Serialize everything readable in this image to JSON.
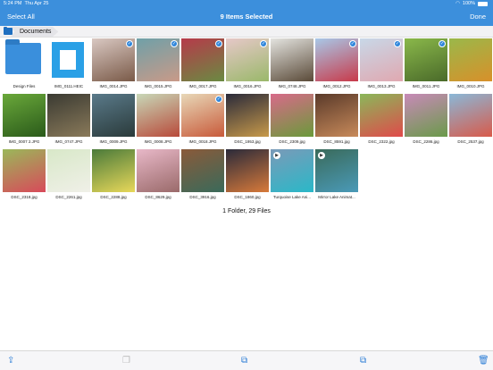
{
  "status_bar": {
    "time": "5:24 PM",
    "date": "Thu Apr 25",
    "battery": "100%"
  },
  "navbar": {
    "left": "Select All",
    "title": "9 Items Selected",
    "right": "Done"
  },
  "breadcrumb": {
    "label": "Documents"
  },
  "files": [
    {
      "name": "Design Files",
      "kind": "folder",
      "selected": false,
      "colors": [
        "#3a8fdc",
        "#3a8fdc"
      ]
    },
    {
      "name": "IMG_0111.HEIC",
      "kind": "doc",
      "selected": false,
      "colors": [
        "#2aa0e6",
        "#2aa0e6"
      ]
    },
    {
      "name": "IMG_0014.JPG",
      "kind": "photo",
      "selected": true,
      "colors": [
        "#d9c8c2",
        "#7a5a48"
      ]
    },
    {
      "name": "IMG_0015.JPG",
      "kind": "photo",
      "selected": true,
      "colors": [
        "#6fa0a8",
        "#c99a88"
      ]
    },
    {
      "name": "IMG_0017.JPG",
      "kind": "photo",
      "selected": true,
      "colors": [
        "#b63a4a",
        "#6a8a42"
      ]
    },
    {
      "name": "IMG_0016.JPG",
      "kind": "photo",
      "selected": true,
      "colors": [
        "#e6c8c8",
        "#9ab86a"
      ]
    },
    {
      "name": "IMG_0748.JPG",
      "kind": "photo",
      "selected": false,
      "colors": [
        "#e4e4e0",
        "#5a4a38"
      ]
    },
    {
      "name": "IMG_0012.JPG",
      "kind": "photo",
      "selected": true,
      "colors": [
        "#a8c8e8",
        "#c83a4a"
      ]
    },
    {
      "name": "IMG_0013.JPG",
      "kind": "photo",
      "selected": true,
      "colors": [
        "#c8d8e8",
        "#e0a8b0"
      ]
    },
    {
      "name": "IMG_0011.JPG",
      "kind": "photo",
      "selected": true,
      "colors": [
        "#8ab84a",
        "#4a6a2a"
      ]
    },
    {
      "name": "IMG_0010.JPG",
      "kind": "photo",
      "selected": false,
      "colors": [
        "#9ab84a",
        "#d8902a"
      ]
    },
    {
      "name": "IMG_0007 2.JPG",
      "kind": "photo",
      "selected": false,
      "colors": [
        "#6aa83a",
        "#2a5a1a"
      ]
    },
    {
      "name": "IMG_0747.JPG",
      "kind": "photo",
      "selected": false,
      "colors": [
        "#3a3a32",
        "#8a7a5a"
      ]
    },
    {
      "name": "IMG_0009.JPG",
      "kind": "photo",
      "selected": false,
      "colors": [
        "#5a7a8a",
        "#2a3a3a"
      ]
    },
    {
      "name": "IMG_0008.JPG",
      "kind": "photo",
      "selected": false,
      "colors": [
        "#c8d8b8",
        "#b84a3a"
      ]
    },
    {
      "name": "IMG_0018.JPG",
      "kind": "photo",
      "selected": true,
      "colors": [
        "#e8d8b8",
        "#c85a3a"
      ]
    },
    {
      "name": "DSC_1953.jpg",
      "kind": "photo",
      "selected": false,
      "colors": [
        "#2a2a3a",
        "#c89a4a"
      ]
    },
    {
      "name": "DSC_2309.jpg",
      "kind": "photo",
      "selected": false,
      "colors": [
        "#d86a8a",
        "#6a9a3a"
      ]
    },
    {
      "name": "DSC_8591.jpg",
      "kind": "photo",
      "selected": false,
      "colors": [
        "#5a3a2a",
        "#c88a5a"
      ]
    },
    {
      "name": "DSC_2322.jpg",
      "kind": "photo",
      "selected": false,
      "colors": [
        "#8ab85a",
        "#e04a4a"
      ]
    },
    {
      "name": "DSC_2286.jpg",
      "kind": "photo",
      "selected": false,
      "colors": [
        "#c88ab8",
        "#6a9a4a"
      ]
    },
    {
      "name": "DSC_2537.jpg",
      "kind": "photo",
      "selected": false,
      "colors": [
        "#8ab8d8",
        "#d85a4a"
      ]
    },
    {
      "name": "DSC_2318.jpg",
      "kind": "photo",
      "selected": false,
      "colors": [
        "#9ab85a",
        "#d84a5a"
      ]
    },
    {
      "name": "DSC_2261.jpg",
      "kind": "photo",
      "selected": false,
      "colors": [
        "#d8e8c8",
        "#f0f0e8"
      ]
    },
    {
      "name": "DSC_2288.jpg",
      "kind": "photo",
      "selected": false,
      "colors": [
        "#4a7a3a",
        "#e8d85a"
      ]
    },
    {
      "name": "DSC_8629.jpg",
      "kind": "photo",
      "selected": false,
      "colors": [
        "#e8b8c8",
        "#9a6a6a"
      ]
    },
    {
      "name": "DSC_3916.jpg",
      "kind": "photo",
      "selected": false,
      "colors": [
        "#8a5a3a",
        "#3a6a5a"
      ]
    },
    {
      "name": "DSC_1860.jpg",
      "kind": "photo",
      "selected": false,
      "colors": [
        "#2a2a3a",
        "#d87a3a"
      ]
    },
    {
      "name": "Turquoise Lake Ani...",
      "kind": "video",
      "selected": false,
      "colors": [
        "#7a9ab8",
        "#2ab8c8"
      ]
    },
    {
      "name": "Mirror Lake Animat...",
      "kind": "video",
      "selected": false,
      "colors": [
        "#3a6a5a",
        "#4a9ab8"
      ]
    }
  ],
  "footer": {
    "summary": "1 Folder, 29 Files"
  },
  "toolbar": {
    "share_icon": "share-icon",
    "copy_icon": "copy-icon",
    "move_icon": "move-icon",
    "move_alt_icon": "move-to-folder-icon",
    "trash_icon": "trash-icon"
  },
  "theme": {
    "accent": "#3c8fdc"
  }
}
